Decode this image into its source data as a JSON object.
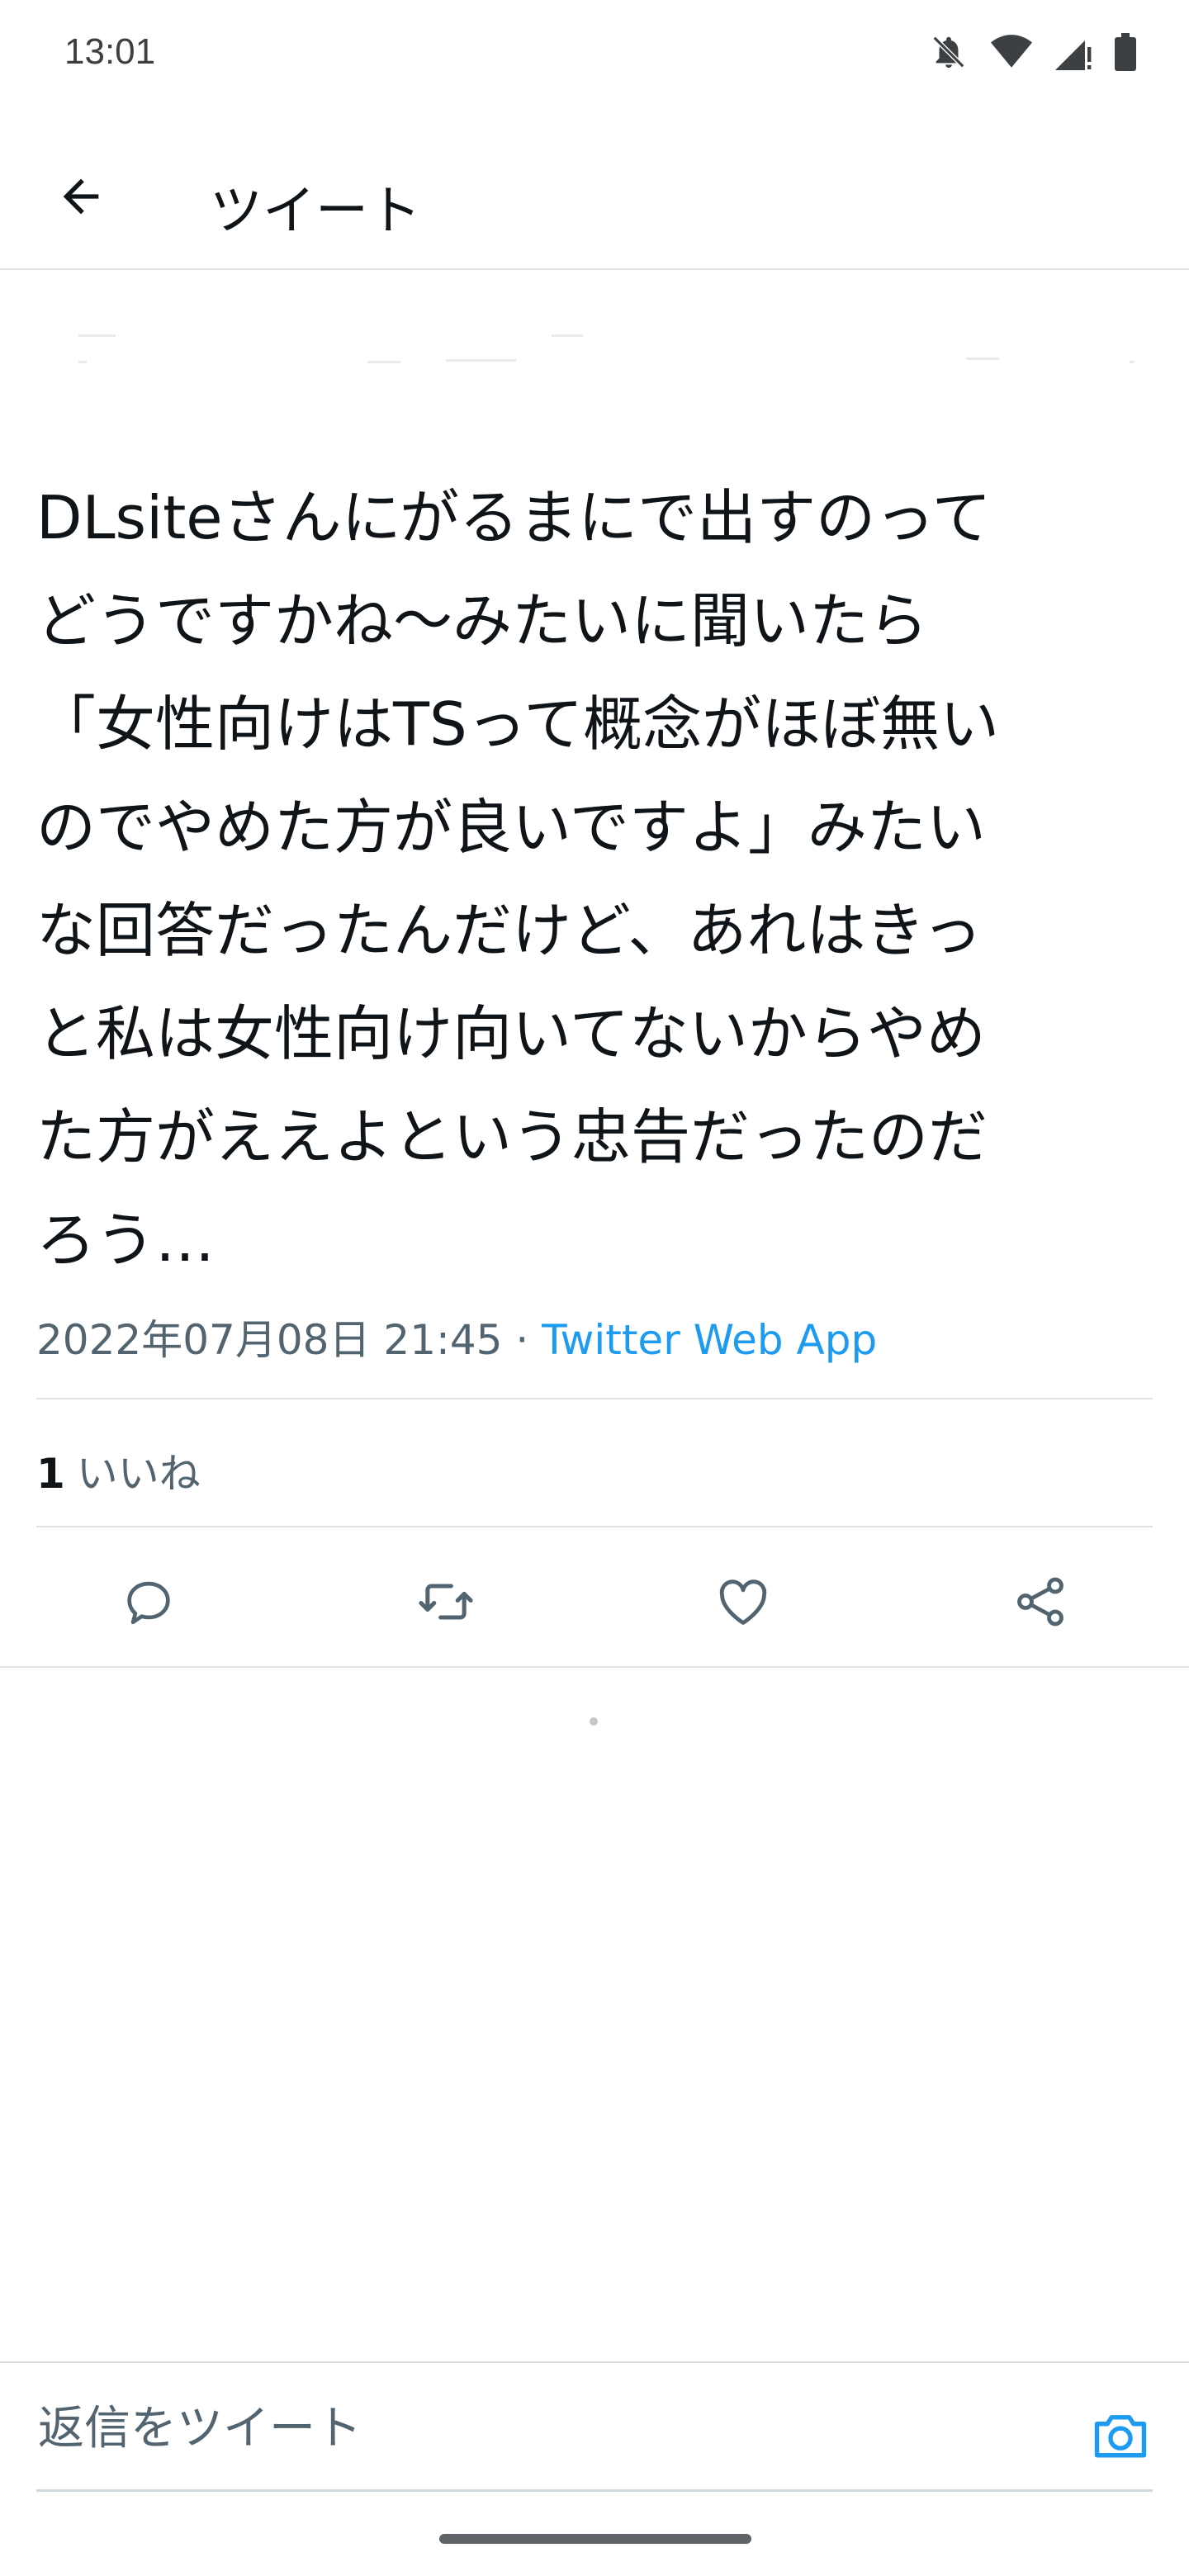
{
  "status": {
    "time": "13:01",
    "icons": [
      "bell-off-icon",
      "wifi-icon",
      "cell-signal-icon",
      "battery-icon"
    ]
  },
  "header": {
    "title": "ツイート",
    "back_icon": "arrow-left-icon"
  },
  "tweet": {
    "text": "DLsiteさんにがるまにで出すのって\nどうですかね〜みたいに聞いたら\n「女性向けはTSって概念がほぼ無い\nのでやめた方が良いですよ」みたい\nな回答だったんだけど、あれはきっ\nと私は女性向け向いてないからやめ\nた方がええよという忠告だったのだ\nろう…",
    "timestamp": "2022年07月08日 21:45",
    "separator": " · ",
    "source": "Twitter Web App",
    "likes_count": "1",
    "likes_label": "いいね"
  },
  "actions": [
    "reply-icon",
    "retweet-icon",
    "like-icon",
    "share-icon"
  ],
  "reply": {
    "placeholder": "返信をツイート",
    "camera_icon": "camera-icon"
  },
  "colors": {
    "accent": "#1d9bf0",
    "text": "#0f1419",
    "muted": "#536471",
    "divider": "#e1e4e6"
  }
}
